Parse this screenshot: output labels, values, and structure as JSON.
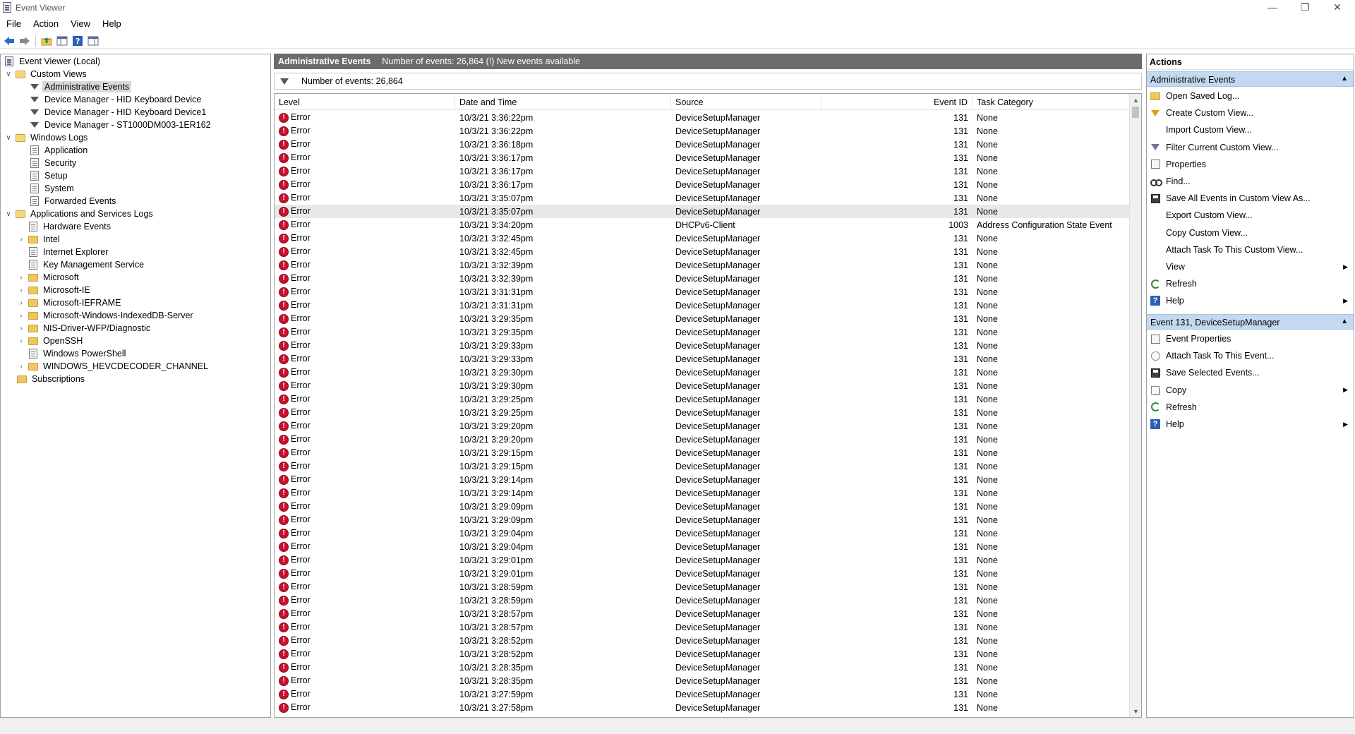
{
  "window": {
    "title": "Event Viewer",
    "min_glyph": "—",
    "restore_glyph": "❐",
    "close_glyph": "✕"
  },
  "menu": [
    "File",
    "Action",
    "View",
    "Help"
  ],
  "tree": {
    "root": "Event Viewer (Local)",
    "custom_views": "Custom Views",
    "custom_view_items": [
      "Administrative Events",
      "Device Manager - HID Keyboard Device",
      "Device Manager - HID Keyboard Device1",
      "Device Manager - ST1000DM003-1ER162"
    ],
    "windows_logs": "Windows Logs",
    "windows_log_items": [
      "Application",
      "Security",
      "Setup",
      "System",
      "Forwarded Events"
    ],
    "app_services": "Applications and Services Logs",
    "app_service_items": [
      {
        "label": "Hardware Events",
        "type": "log",
        "expandable": false
      },
      {
        "label": "Intel",
        "type": "folder",
        "expandable": true
      },
      {
        "label": "Internet Explorer",
        "type": "log",
        "expandable": false
      },
      {
        "label": "Key Management Service",
        "type": "log",
        "expandable": false
      },
      {
        "label": "Microsoft",
        "type": "folder",
        "expandable": true
      },
      {
        "label": "Microsoft-IE",
        "type": "folder",
        "expandable": true
      },
      {
        "label": "Microsoft-IEFRAME",
        "type": "folder",
        "expandable": true
      },
      {
        "label": "Microsoft-Windows-IndexedDB-Server",
        "type": "folder",
        "expandable": true
      },
      {
        "label": "NIS-Driver-WFP/Diagnostic",
        "type": "folder",
        "expandable": true
      },
      {
        "label": "OpenSSH",
        "type": "folder",
        "expandable": true
      },
      {
        "label": "Windows PowerShell",
        "type": "log",
        "expandable": false
      },
      {
        "label": "WINDOWS_HEVCDECODER_CHANNEL",
        "type": "folder",
        "expandable": true
      }
    ],
    "subscriptions": "Subscriptions"
  },
  "center": {
    "header_title": "Administrative Events",
    "header_info": "Number of events: 26,864 (!) New events available",
    "filter_text": "Number of events: 26,864",
    "columns": [
      "Level",
      "Date and Time",
      "Source",
      "Event ID",
      "Task Category"
    ],
    "rows": [
      [
        "Error",
        "10/3/21 3:36:22pm",
        "DeviceSetupManager",
        "131",
        "None"
      ],
      [
        "Error",
        "10/3/21 3:36:22pm",
        "DeviceSetupManager",
        "131",
        "None"
      ],
      [
        "Error",
        "10/3/21 3:36:18pm",
        "DeviceSetupManager",
        "131",
        "None"
      ],
      [
        "Error",
        "10/3/21 3:36:17pm",
        "DeviceSetupManager",
        "131",
        "None"
      ],
      [
        "Error",
        "10/3/21 3:36:17pm",
        "DeviceSetupManager",
        "131",
        "None"
      ],
      [
        "Error",
        "10/3/21 3:36:17pm",
        "DeviceSetupManager",
        "131",
        "None"
      ],
      [
        "Error",
        "10/3/21 3:35:07pm",
        "DeviceSetupManager",
        "131",
        "None"
      ],
      [
        "Error",
        "10/3/21 3:35:07pm",
        "DeviceSetupManager",
        "131",
        "None"
      ],
      [
        "Error",
        "10/3/21 3:34:20pm",
        "DHCPv6-Client",
        "1003",
        "Address Configuration State Event"
      ],
      [
        "Error",
        "10/3/21 3:32:45pm",
        "DeviceSetupManager",
        "131",
        "None"
      ],
      [
        "Error",
        "10/3/21 3:32:45pm",
        "DeviceSetupManager",
        "131",
        "None"
      ],
      [
        "Error",
        "10/3/21 3:32:39pm",
        "DeviceSetupManager",
        "131",
        "None"
      ],
      [
        "Error",
        "10/3/21 3:32:39pm",
        "DeviceSetupManager",
        "131",
        "None"
      ],
      [
        "Error",
        "10/3/21 3:31:31pm",
        "DeviceSetupManager",
        "131",
        "None"
      ],
      [
        "Error",
        "10/3/21 3:31:31pm",
        "DeviceSetupManager",
        "131",
        "None"
      ],
      [
        "Error",
        "10/3/21 3:29:35pm",
        "DeviceSetupManager",
        "131",
        "None"
      ],
      [
        "Error",
        "10/3/21 3:29:35pm",
        "DeviceSetupManager",
        "131",
        "None"
      ],
      [
        "Error",
        "10/3/21 3:29:33pm",
        "DeviceSetupManager",
        "131",
        "None"
      ],
      [
        "Error",
        "10/3/21 3:29:33pm",
        "DeviceSetupManager",
        "131",
        "None"
      ],
      [
        "Error",
        "10/3/21 3:29:30pm",
        "DeviceSetupManager",
        "131",
        "None"
      ],
      [
        "Error",
        "10/3/21 3:29:30pm",
        "DeviceSetupManager",
        "131",
        "None"
      ],
      [
        "Error",
        "10/3/21 3:29:25pm",
        "DeviceSetupManager",
        "131",
        "None"
      ],
      [
        "Error",
        "10/3/21 3:29:25pm",
        "DeviceSetupManager",
        "131",
        "None"
      ],
      [
        "Error",
        "10/3/21 3:29:20pm",
        "DeviceSetupManager",
        "131",
        "None"
      ],
      [
        "Error",
        "10/3/21 3:29:20pm",
        "DeviceSetupManager",
        "131",
        "None"
      ],
      [
        "Error",
        "10/3/21 3:29:15pm",
        "DeviceSetupManager",
        "131",
        "None"
      ],
      [
        "Error",
        "10/3/21 3:29:15pm",
        "DeviceSetupManager",
        "131",
        "None"
      ],
      [
        "Error",
        "10/3/21 3:29:14pm",
        "DeviceSetupManager",
        "131",
        "None"
      ],
      [
        "Error",
        "10/3/21 3:29:14pm",
        "DeviceSetupManager",
        "131",
        "None"
      ],
      [
        "Error",
        "10/3/21 3:29:09pm",
        "DeviceSetupManager",
        "131",
        "None"
      ],
      [
        "Error",
        "10/3/21 3:29:09pm",
        "DeviceSetupManager",
        "131",
        "None"
      ],
      [
        "Error",
        "10/3/21 3:29:04pm",
        "DeviceSetupManager",
        "131",
        "None"
      ],
      [
        "Error",
        "10/3/21 3:29:04pm",
        "DeviceSetupManager",
        "131",
        "None"
      ],
      [
        "Error",
        "10/3/21 3:29:01pm",
        "DeviceSetupManager",
        "131",
        "None"
      ],
      [
        "Error",
        "10/3/21 3:29:01pm",
        "DeviceSetupManager",
        "131",
        "None"
      ],
      [
        "Error",
        "10/3/21 3:28:59pm",
        "DeviceSetupManager",
        "131",
        "None"
      ],
      [
        "Error",
        "10/3/21 3:28:59pm",
        "DeviceSetupManager",
        "131",
        "None"
      ],
      [
        "Error",
        "10/3/21 3:28:57pm",
        "DeviceSetupManager",
        "131",
        "None"
      ],
      [
        "Error",
        "10/3/21 3:28:57pm",
        "DeviceSetupManager",
        "131",
        "None"
      ],
      [
        "Error",
        "10/3/21 3:28:52pm",
        "DeviceSetupManager",
        "131",
        "None"
      ],
      [
        "Error",
        "10/3/21 3:28:52pm",
        "DeviceSetupManager",
        "131",
        "None"
      ],
      [
        "Error",
        "10/3/21 3:28:35pm",
        "DeviceSetupManager",
        "131",
        "None"
      ],
      [
        "Error",
        "10/3/21 3:28:35pm",
        "DeviceSetupManager",
        "131",
        "None"
      ],
      [
        "Error",
        "10/3/21 3:27:59pm",
        "DeviceSetupManager",
        "131",
        "None"
      ],
      [
        "Error",
        "10/3/21 3:27:58pm",
        "DeviceSetupManager",
        "131",
        "None"
      ]
    ],
    "selected_row": 7
  },
  "actions": {
    "title": "Actions",
    "section1": {
      "title": "Administrative Events",
      "items": [
        {
          "label": "Open Saved Log...",
          "icon": "open-log-icon",
          "submenu": false
        },
        {
          "label": "Create Custom View...",
          "icon": "create-filter-icon",
          "submenu": false
        },
        {
          "label": "Import Custom View...",
          "icon": "",
          "submenu": false
        },
        {
          "label": "Filter Current Custom View...",
          "icon": "filter-icon",
          "submenu": false
        },
        {
          "label": "Properties",
          "icon": "properties-icon",
          "submenu": false
        },
        {
          "label": "Find...",
          "icon": "find-icon",
          "submenu": false
        },
        {
          "label": "Save All Events in Custom View As...",
          "icon": "save-icon",
          "submenu": false
        },
        {
          "label": "Export Custom View...",
          "icon": "",
          "submenu": false
        },
        {
          "label": "Copy Custom View...",
          "icon": "",
          "submenu": false
        },
        {
          "label": "Attach Task To This Custom View...",
          "icon": "",
          "submenu": false
        },
        {
          "label": "View",
          "icon": "",
          "submenu": true
        },
        {
          "label": "Refresh",
          "icon": "refresh-icon",
          "submenu": false
        },
        {
          "label": "Help",
          "icon": "help-icon",
          "submenu": true
        }
      ]
    },
    "section2": {
      "title": "Event 131, DeviceSetupManager",
      "items": [
        {
          "label": "Event Properties",
          "icon": "properties-icon",
          "submenu": false
        },
        {
          "label": "Attach Task To This Event...",
          "icon": "task-icon",
          "submenu": false
        },
        {
          "label": "Save Selected Events...",
          "icon": "save-icon",
          "submenu": false
        },
        {
          "label": "Copy",
          "icon": "copy-icon",
          "submenu": true
        },
        {
          "label": "Refresh",
          "icon": "refresh-icon",
          "submenu": false
        },
        {
          "label": "Help",
          "icon": "help-icon",
          "submenu": true
        }
      ]
    }
  },
  "colors": {
    "header_bg": "#6b6b6b",
    "section_bg": "#c4d9ef",
    "error": "#c8102e",
    "selected_row": "#e8e8e8"
  }
}
